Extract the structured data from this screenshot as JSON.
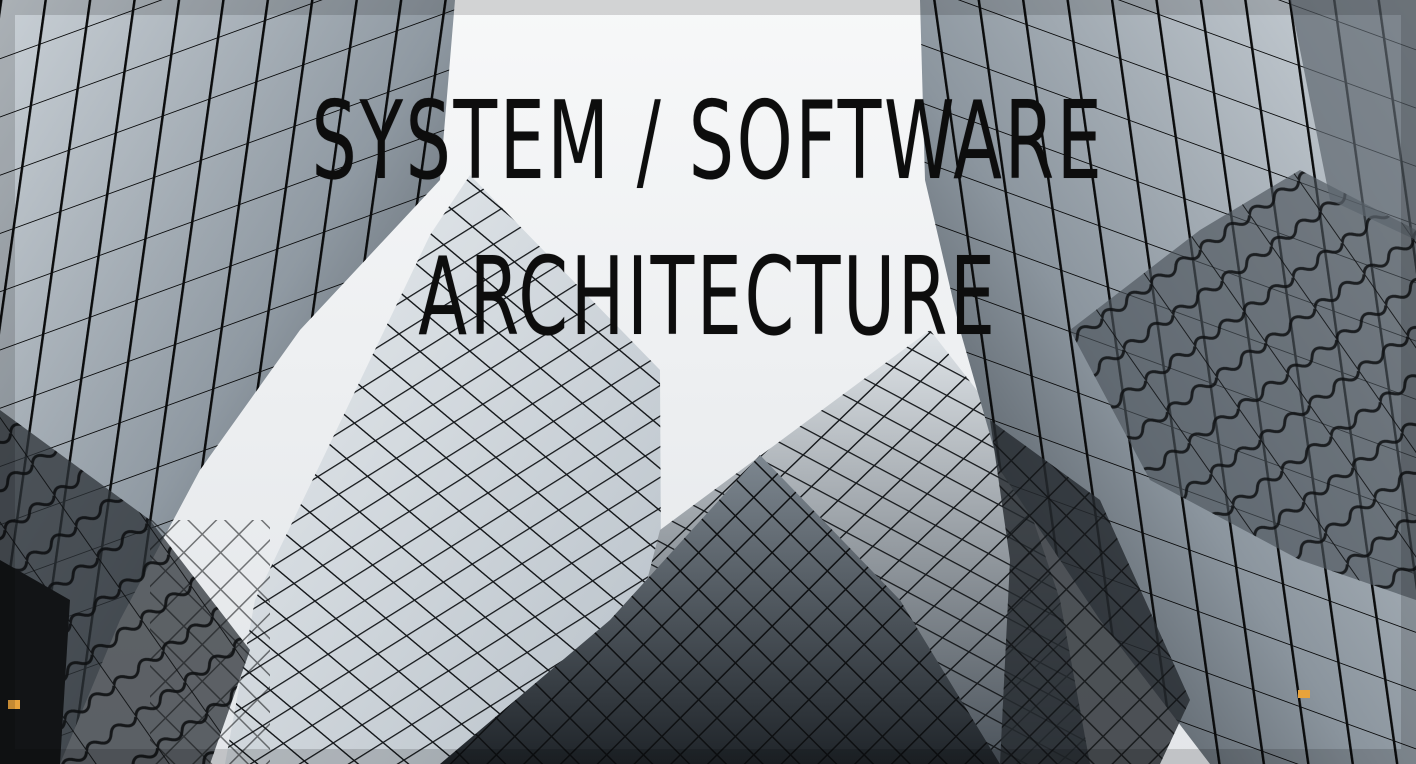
{
  "title": {
    "line1": "SYSTEM / SOFTWARE",
    "line2": "ARCHITECTURE"
  },
  "colors": {
    "sky": "#f2f3f4",
    "glass_light": "#dfe5ea",
    "glass_mid": "#9ea7b0",
    "glass_dark": "#3b4249",
    "mullion": "#0b0c0d",
    "title_text": "#0d0d0d"
  }
}
